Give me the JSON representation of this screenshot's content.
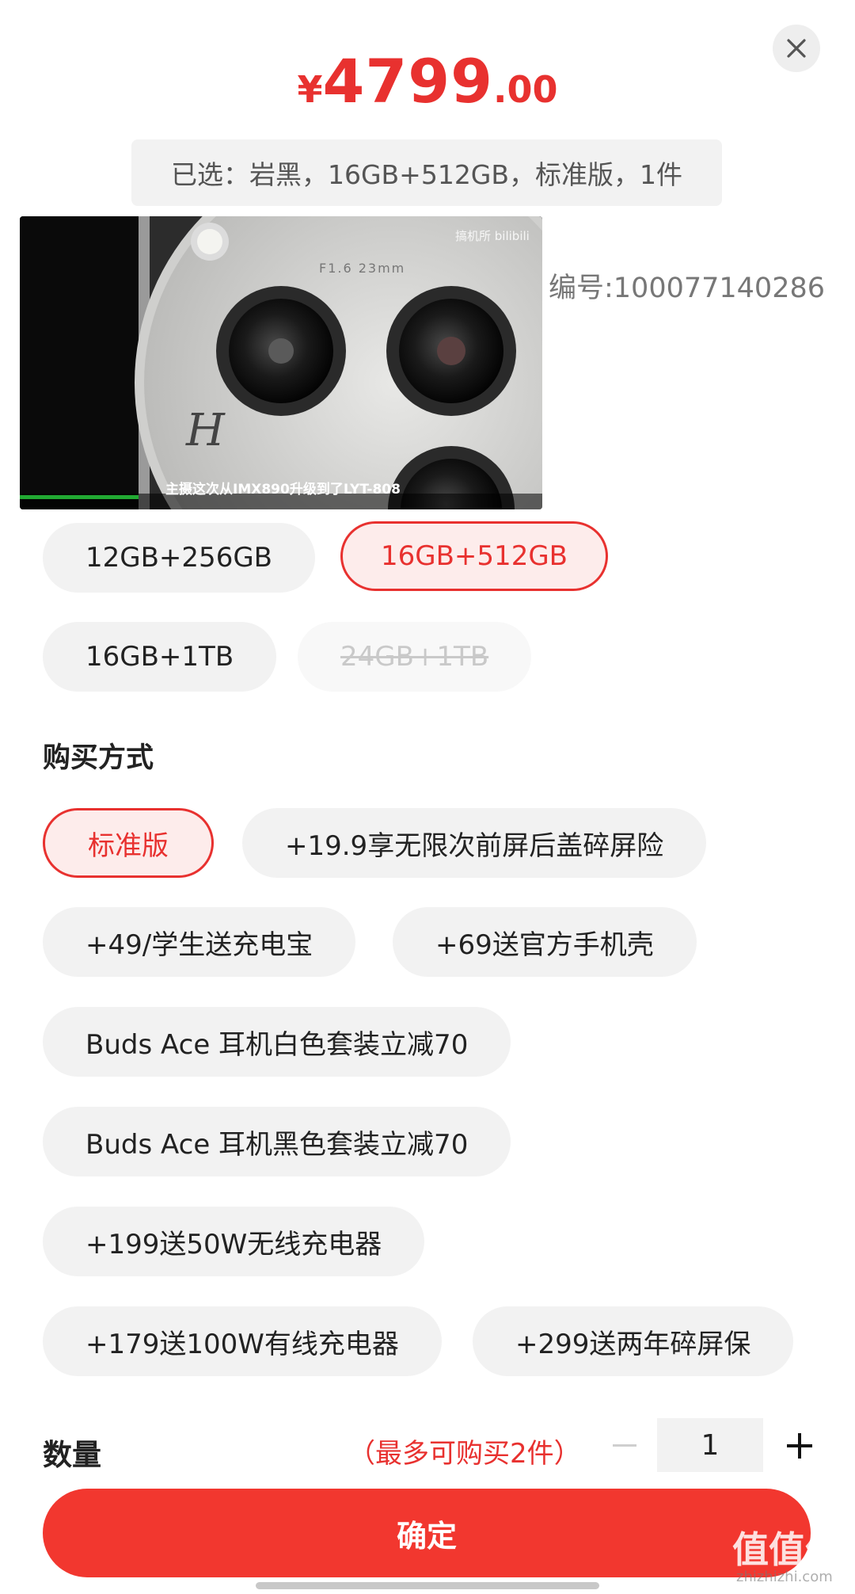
{
  "price": {
    "symbol": "¥",
    "integer": "4799",
    "decimal": ".00"
  },
  "selected_summary": "已选：岩黑，16GB+512GB，标准版，1件",
  "product_thumbnail": {
    "watermark": "搞机所 bilibili",
    "lens_text": "F1.6 23mm",
    "brand_mark": "H",
    "subtitle": "主摄这次从IMX890升级到了LYT-808"
  },
  "sku_code": "编号:100077140286",
  "storage_options": [
    {
      "label": "12GB+256GB",
      "state": "normal"
    },
    {
      "label": "16GB+512GB",
      "state": "selected"
    },
    {
      "label": "16GB+1TB",
      "state": "normal"
    },
    {
      "label": "24GB+1TB",
      "state": "disabled"
    }
  ],
  "purchase_section": {
    "title": "购买方式",
    "options": [
      {
        "label": "标准版",
        "state": "selected"
      },
      {
        "label": "+19.9享无限次前屏后盖碎屏险",
        "state": "normal"
      },
      {
        "label": "+49/学生送充电宝",
        "state": "normal"
      },
      {
        "label": "+69送官方手机壳",
        "state": "normal"
      },
      {
        "label": "Buds Ace 耳机白色套装立减70",
        "state": "normal"
      },
      {
        "label": "Buds Ace 耳机黑色套装立减70",
        "state": "normal"
      },
      {
        "label": "+199送50W无线充电器",
        "state": "normal"
      },
      {
        "label": "+179送100W有线充电器",
        "state": "normal"
      },
      {
        "label": "+299送两年碎屏保",
        "state": "normal"
      }
    ]
  },
  "quantity": {
    "label": "数量",
    "limit_note": "（最多可购买2件）",
    "value": "1"
  },
  "confirm_label": "确定",
  "watermark": {
    "text": "值值值",
    "sub": "zhizhizhi.com"
  },
  "colors": {
    "accent": "#e8312f",
    "chip_bg": "#f2f2f2",
    "selected_bg": "#fdeceb",
    "confirm_bg": "#f2372f"
  },
  "icons": {
    "close": "close-icon",
    "minus": "minus-icon",
    "plus": "plus-icon"
  }
}
